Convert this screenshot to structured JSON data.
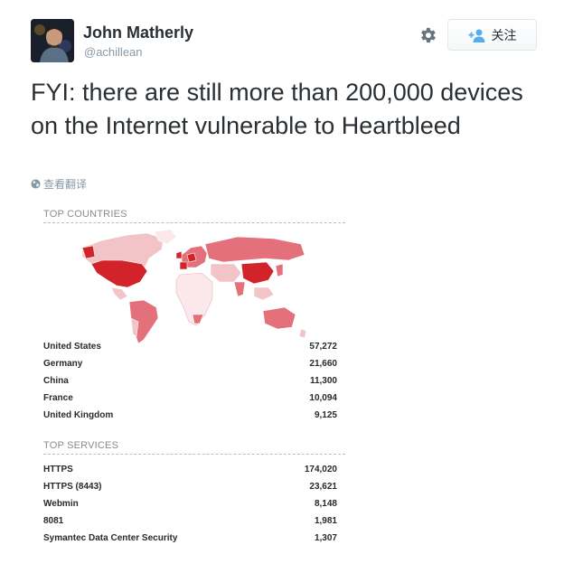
{
  "user": {
    "name": "John Matherly",
    "handle": "@achillean"
  },
  "actions": {
    "follow_label": "关注"
  },
  "tweet": {
    "text": "FYI: there are still more than 200,000 devices on the Internet vulnerable to Heartbleed",
    "translate_label": "查看翻译"
  },
  "top_countries": {
    "title": "TOP COUNTRIES",
    "items": [
      {
        "label": "United States",
        "value": "57,272"
      },
      {
        "label": "Germany",
        "value": "21,660"
      },
      {
        "label": "China",
        "value": "11,300"
      },
      {
        "label": "France",
        "value": "10,094"
      },
      {
        "label": "United Kingdom",
        "value": "9,125"
      }
    ]
  },
  "top_services": {
    "title": "TOP SERVICES",
    "items": [
      {
        "label": "HTTPS",
        "value": "174,020"
      },
      {
        "label": "HTTPS (8443)",
        "value": "23,621"
      },
      {
        "label": "Webmin",
        "value": "8,148"
      },
      {
        "label": "8081",
        "value": "1,981"
      },
      {
        "label": "Symantec Data Center Security",
        "value": "1,307"
      }
    ]
  },
  "icons": {
    "gear": "gear-icon",
    "follow": "add-user-icon",
    "translate": "globe-icon"
  },
  "colors": {
    "accent_red": "#c8102e",
    "map_dark": "#d2232a",
    "map_mid": "#e3707a",
    "map_light": "#f2c4c8",
    "map_pale": "#fbe8ea"
  }
}
